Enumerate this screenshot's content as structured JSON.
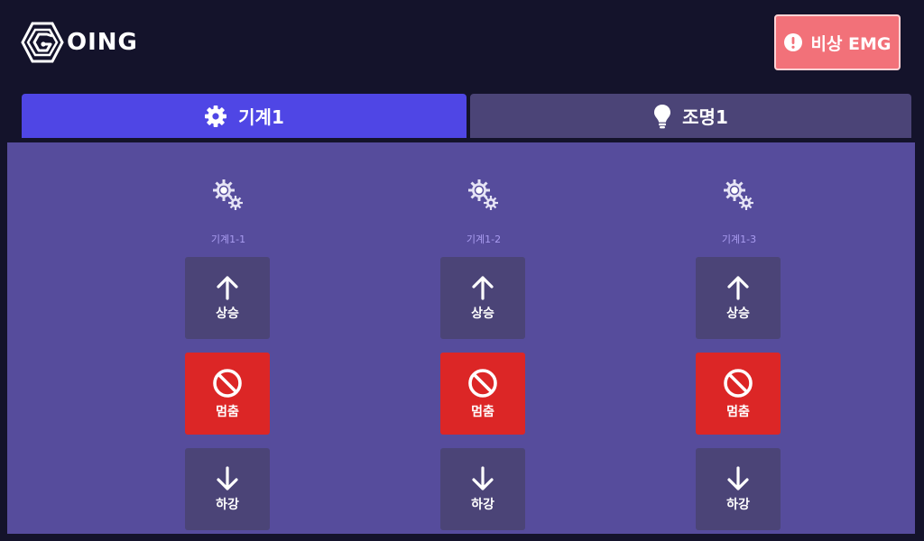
{
  "header": {
    "logo_text": "OING",
    "emergency_label": "비상 EMG"
  },
  "tabs": [
    {
      "label": "기계1",
      "icon": "gear-icon",
      "active": true
    },
    {
      "label": "조명1",
      "icon": "lightbulb-icon",
      "active": false
    }
  ],
  "machines": [
    {
      "label": "기계1-1",
      "up_label": "상승",
      "stop_label": "멈춤",
      "down_label": "하강"
    },
    {
      "label": "기계1-2",
      "up_label": "상승",
      "stop_label": "멈춤",
      "down_label": "하강"
    },
    {
      "label": "기계1-3",
      "up_label": "상승",
      "stop_label": "멈춤",
      "down_label": "하강"
    }
  ],
  "colors": {
    "background": "#14132b",
    "tab_active": "#4f46e5",
    "tab_inactive": "#4b4477",
    "panel": "#564c9c",
    "stop": "#dc2626",
    "emergency": "#f27179"
  }
}
